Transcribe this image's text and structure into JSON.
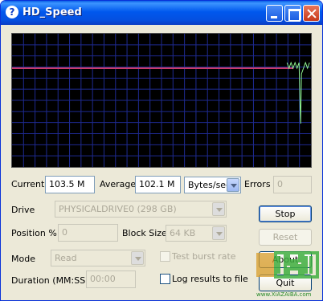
{
  "window": {
    "title": "HD_Speed"
  },
  "monitor": {
    "avg_line_color": "#c83a6a",
    "trace_color": "#8ff28f",
    "grid_color": "#1e2a90",
    "trace_segment": {
      "from_fraction": 0.92,
      "to_fraction": 1.0
    }
  },
  "stats": {
    "current_label": "Current",
    "current_value": "103.5 M",
    "average_label": "Average",
    "average_value": "102.1 M",
    "unit_selected": "Bytes/sec",
    "errors_label": "Errors",
    "errors_value": "0"
  },
  "drive": {
    "label": "Drive",
    "selected": "PHYSICALDRIVE0 (298 GB)"
  },
  "position": {
    "label": "Position %",
    "value": "0"
  },
  "block_size": {
    "label": "Block Size",
    "selected": "64 KB"
  },
  "mode": {
    "label": "Mode",
    "selected": "Read"
  },
  "duration": {
    "label": "Duration (MM:SS)",
    "value": "00:00"
  },
  "options": {
    "test_burst_rate": {
      "label": "Test burst rate",
      "checked": false
    },
    "log_results": {
      "label": "Log results to file",
      "checked": false
    }
  },
  "buttons": {
    "stop": "Stop",
    "reset": "Reset",
    "about": "About",
    "quit": "Quit"
  },
  "watermark": {
    "url": "www.XiAZAiBA.com"
  }
}
